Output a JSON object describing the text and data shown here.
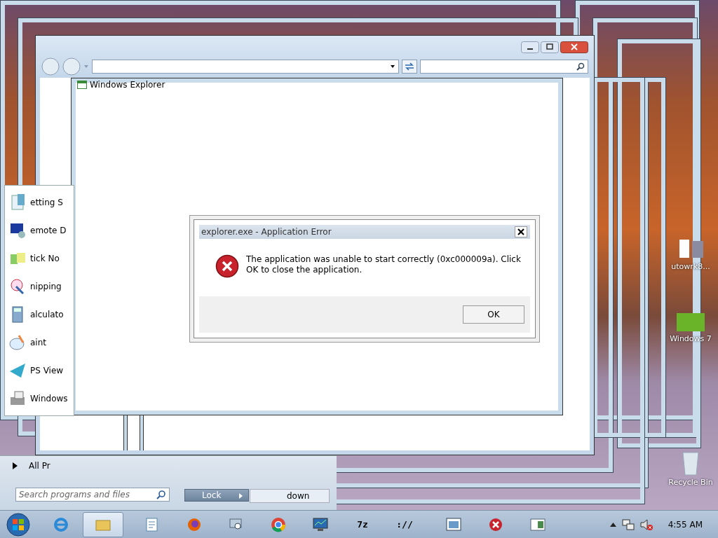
{
  "explorer_window": {
    "title": "Windows Explorer"
  },
  "start_menu": {
    "programs": [
      {
        "label": "etting S"
      },
      {
        "label": "emote D"
      },
      {
        "label": "tick No"
      },
      {
        "label": "nipping"
      },
      {
        "label": "alculato"
      },
      {
        "label": "aint"
      },
      {
        "label": "PS View"
      },
      {
        "label": "Windows"
      }
    ],
    "all_programs": "All Pr",
    "search": {
      "placeholder": "Search programs and files"
    },
    "lock_button": "Lock",
    "shutdown_button": "down"
  },
  "desktop_icons": [
    {
      "label": "utowrk8...",
      "kind": "shortcut"
    },
    {
      "label": "Windows 7",
      "kind": "green"
    },
    {
      "label": "Recycle Bin",
      "kind": "bin"
    }
  ],
  "dialog": {
    "title": "explorer.exe - Application Error",
    "message": "The application was unable to start correctly (0xc000009a). Click OK to close the application.",
    "button": "OK"
  },
  "taskbar": {
    "items": [
      {
        "kind": "ie",
        "selected": false
      },
      {
        "kind": "folder",
        "selected": true
      },
      {
        "kind": "notepad",
        "selected": false
      },
      {
        "kind": "firefox",
        "selected": false
      },
      {
        "kind": "magnifier",
        "selected": false
      },
      {
        "kind": "chrome",
        "selected": false
      },
      {
        "kind": "monitor",
        "selected": false
      },
      {
        "kind": "text",
        "text": "7z",
        "selected": false
      },
      {
        "kind": "text",
        "text": "://",
        "selected": false
      },
      {
        "kind": "window-pic",
        "selected": false
      },
      {
        "kind": "error",
        "selected": false
      },
      {
        "kind": "window",
        "selected": false
      }
    ],
    "clock": "4:55 AM"
  }
}
